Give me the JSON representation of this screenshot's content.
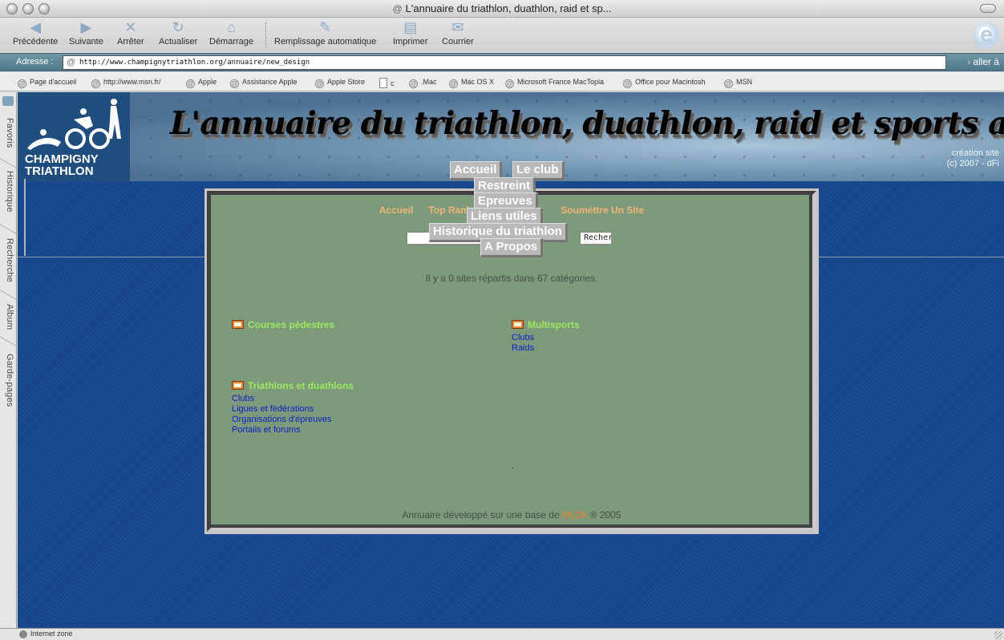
{
  "window": {
    "title": "L'annuaire du triathlon, duathlon, raid et sp..."
  },
  "toolbar": {
    "back": "Précédente",
    "forward": "Suivante",
    "stop": "Arrêter",
    "refresh": "Actualiser",
    "home": "Démarrage",
    "autofill": "Remplissage automatique",
    "print": "Imprimer",
    "mail": "Courrier"
  },
  "address": {
    "label": "Adresse :",
    "url": "http://www.champignytriathlon.org/annuaire/new_design",
    "go": "aller à"
  },
  "favorites": [
    "Page d'accueil",
    "http://www.msn.fr/",
    "Apple",
    "Assistance Apple",
    "Apple Store",
    "c",
    ".Mac",
    "Mac OS X",
    "Microsoft France MacTopia",
    "Office pour Macintosh",
    "MSN"
  ],
  "sidetabs": [
    "Favoris",
    "Historique",
    "Recherche",
    "Album",
    "Garde-pages"
  ],
  "banner": {
    "logo_line1": "CHAMPIGNY",
    "logo_line2": "TRIATHLON",
    "title": "L'annuaire du triathlon, duathlon, raid et sports associés",
    "credit1": "création site",
    "credit2": "(c) 2007 - dFi"
  },
  "menu": {
    "accueil": "Accueil",
    "club": "Le club",
    "restreint": "Restreint",
    "epreuves": "Epreuves",
    "liens": "Liens utiles",
    "historique": "Historique du triathlon",
    "apropos": "A Propos"
  },
  "topnav": {
    "accueil": "Accueil",
    "top": "Top Rank",
    "submit": "Soumettre Un Site"
  },
  "search": {
    "button": "Rechercher"
  },
  "count_text": "Il y a 0 sites répartis dans 67 catégories.",
  "categories": {
    "courses": {
      "title": "Courses pédestres"
    },
    "multisports": {
      "title": "Multisports",
      "links": [
        "Clubs",
        "Raids"
      ]
    },
    "triathlons": {
      "title": "Triathlons et duathlons",
      "links": [
        "Clubs",
        "Ligues et fédérations",
        "Organisations d'épreuves",
        "Portails et forums"
      ]
    }
  },
  "footer": {
    "text": "Annuaire développé sur une base de",
    "brand": "MyDir",
    "suffix": "® 2005"
  },
  "status": {
    "text": "Internet zone"
  }
}
